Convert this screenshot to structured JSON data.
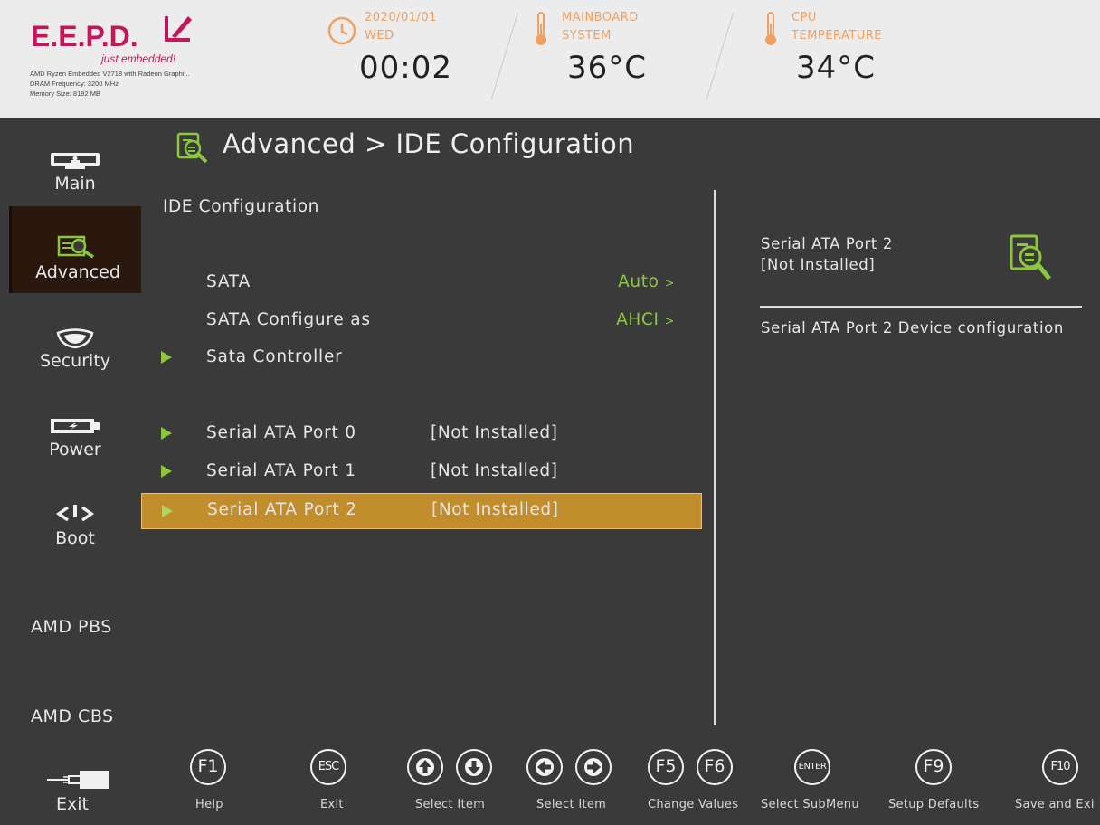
{
  "header": {
    "logo": "E.E.P.D.",
    "tagline": "just embedded!",
    "sysinfo": [
      "AMD Ryzen Embedded V2718 with Radeon Graphi...",
      "DRAM Frequency: 3200 MHz",
      "Memory Size: 8192 MB"
    ],
    "date": "2020/01/01",
    "day": "WED",
    "time": "00:02",
    "mainboard_label_1": "MAINBOARD",
    "mainboard_label_2": "SYSTEM",
    "mainboard_temp": "36°C",
    "cpu_label_1": "CPU",
    "cpu_label_2": "TEMPERATURE",
    "cpu_temp": "34°C"
  },
  "sidebar": {
    "items": [
      {
        "label": "Main",
        "icon": "monitor-icon"
      },
      {
        "label": "Advanced",
        "icon": "search-document-icon",
        "active": true
      },
      {
        "label": "Security",
        "icon": "shield-icon"
      },
      {
        "label": "Power",
        "icon": "battery-icon"
      },
      {
        "label": "Boot",
        "icon": "power-boot-icon"
      },
      {
        "label": "AMD PBS"
      },
      {
        "label": "AMD CBS"
      },
      {
        "label": "Exit",
        "icon": "exit-plug-icon"
      }
    ]
  },
  "main": {
    "breadcrumb": "Advanced > IDE Configuration",
    "section_title": "IDE Configuration",
    "rows": [
      {
        "label": "SATA",
        "value": "Auto",
        "submenu": false
      },
      {
        "label": "SATA Configure as",
        "value": "AHCI",
        "submenu": false
      },
      {
        "label": "Sata Controller",
        "submenu": true
      },
      {
        "label": "Serial ATA Port 0",
        "status": "[Not Installed]",
        "submenu": true
      },
      {
        "label": "Serial ATA Port 1",
        "status": "[Not Installed]",
        "submenu": true
      },
      {
        "label": "Serial ATA Port 2",
        "status": "[Not Installed]",
        "submenu": true,
        "selected": true
      }
    ],
    "value_arrow": ">"
  },
  "help": {
    "title_line1": "Serial ATA Port 2",
    "title_line2": "[Not Installed]",
    "description": "Serial ATA Port 2 Device configuration"
  },
  "footer": {
    "keys": [
      {
        "key": "F1",
        "label": "Help"
      },
      {
        "key": "ESC",
        "label": "Exit"
      },
      {
        "key": "up-down",
        "label": "Select Item"
      },
      {
        "key": "left-right",
        "label": "Select Item"
      },
      {
        "key": "F5F6",
        "label": "Change Values"
      },
      {
        "key": "ENTER",
        "label": "Select SubMenu"
      },
      {
        "key": "F9",
        "label": "Setup Defaults"
      },
      {
        "key": "F10",
        "label": "Save and Exi"
      }
    ]
  },
  "colors": {
    "accent_green": "#8cc63f",
    "selected_row": "#c28d2c",
    "brand_magenta": "#c2185b",
    "header_orange": "#f0a060",
    "background": "#3a3a3a"
  }
}
